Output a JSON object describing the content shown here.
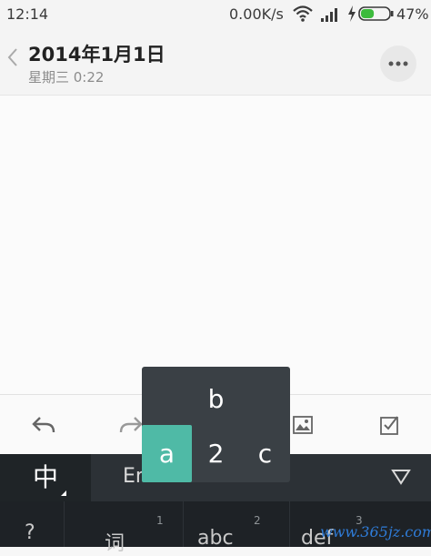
{
  "status_bar": {
    "time": "12:14",
    "net_speed": "0.00K/s",
    "battery_percent": "47%",
    "battery_level": 0.47,
    "icons": [
      "wifi-icon",
      "signal-icon",
      "charging-icon",
      "battery-icon"
    ]
  },
  "header": {
    "title": "2014年1月1日",
    "subtitle": "星期三 0:22",
    "back_icon": "chevron-left-icon",
    "more_icon": "more-horizontal-icon"
  },
  "toolbar": {
    "icons": [
      "undo-icon",
      "redo-icon",
      "image-icon",
      "checkbox-icon"
    ]
  },
  "keyboard": {
    "lang_chinese": "中",
    "lang_english": "En",
    "collapse_icon": "triangle-down-icon",
    "keys": [
      {
        "label": "?",
        "number": ""
      },
      {
        "label": "词",
        "number": "1"
      },
      {
        "label": "abc",
        "number": "2"
      },
      {
        "label": "def",
        "number": "3"
      }
    ]
  },
  "key_popup": {
    "top": "b",
    "left": "a",
    "center": "2",
    "right": "c",
    "selected": "a"
  },
  "watermark": "www.365jz.com",
  "colors": {
    "accent": "#4fbaa6",
    "battery_green": "#3dbb3d",
    "keyboard_dark": "#2c3136",
    "popup_bg": "#3a4045",
    "watermark_blue": "#2f7cd8"
  }
}
